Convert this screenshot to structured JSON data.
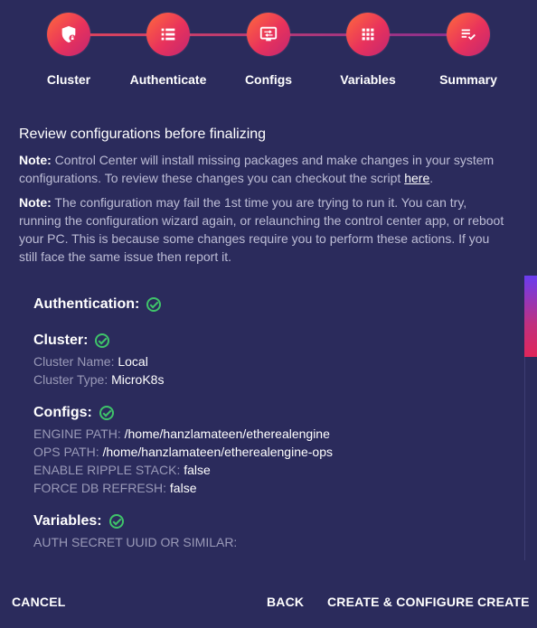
{
  "stepper": {
    "steps": [
      {
        "label": "Cluster",
        "icon": "shield-lock-icon"
      },
      {
        "label": "Authenticate",
        "icon": "list-icon"
      },
      {
        "label": "Configs",
        "icon": "settings-display-icon"
      },
      {
        "label": "Variables",
        "icon": "grid-icon"
      },
      {
        "label": "Summary",
        "icon": "list-check-icon"
      }
    ],
    "accent_start": "#ff6a3c",
    "accent_end": "#c22771"
  },
  "main": {
    "heading": "Review configurations before finalizing",
    "note1_prefix": "Note:",
    "note1_text": " Control Center will install missing packages and make changes in your system configurations. To review these changes you can checkout the script ",
    "note1_link": "here",
    "note1_suffix": ".",
    "note2_prefix": "Note:",
    "note2_text": " The configuration may fail the 1st time you are trying to run it. You can try, running the configuration wizard again, or relaunching the control center app, or reboot your PC. This is because some changes require you to perform these actions. If you still face the same issue then report it."
  },
  "summary": {
    "authentication": {
      "title": "Authentication:"
    },
    "cluster": {
      "title": "Cluster:",
      "rows": [
        {
          "key": "Cluster Name:",
          "value": "Local"
        },
        {
          "key": "Cluster Type:",
          "value": "MicroK8s"
        }
      ]
    },
    "configs": {
      "title": "Configs:",
      "rows": [
        {
          "key": "ENGINE PATH:",
          "value": "/home/hanzlamateen/etherealengine"
        },
        {
          "key": "OPS PATH:",
          "value": "/home/hanzlamateen/etherealengine-ops"
        },
        {
          "key": "ENABLE RIPPLE STACK:",
          "value": "false"
        },
        {
          "key": "FORCE DB REFRESH:",
          "value": "false"
        }
      ]
    },
    "variables": {
      "title": "Variables:",
      "rows": [
        {
          "key": "AUTH SECRET UUID OR SIMILAR:",
          "value": ""
        }
      ]
    },
    "check_color": "#3fc46a"
  },
  "footer": {
    "cancel": "CANCEL",
    "back": "BACK",
    "create_configure": "CREATE & CONFIGURE",
    "create": "CREATE"
  }
}
